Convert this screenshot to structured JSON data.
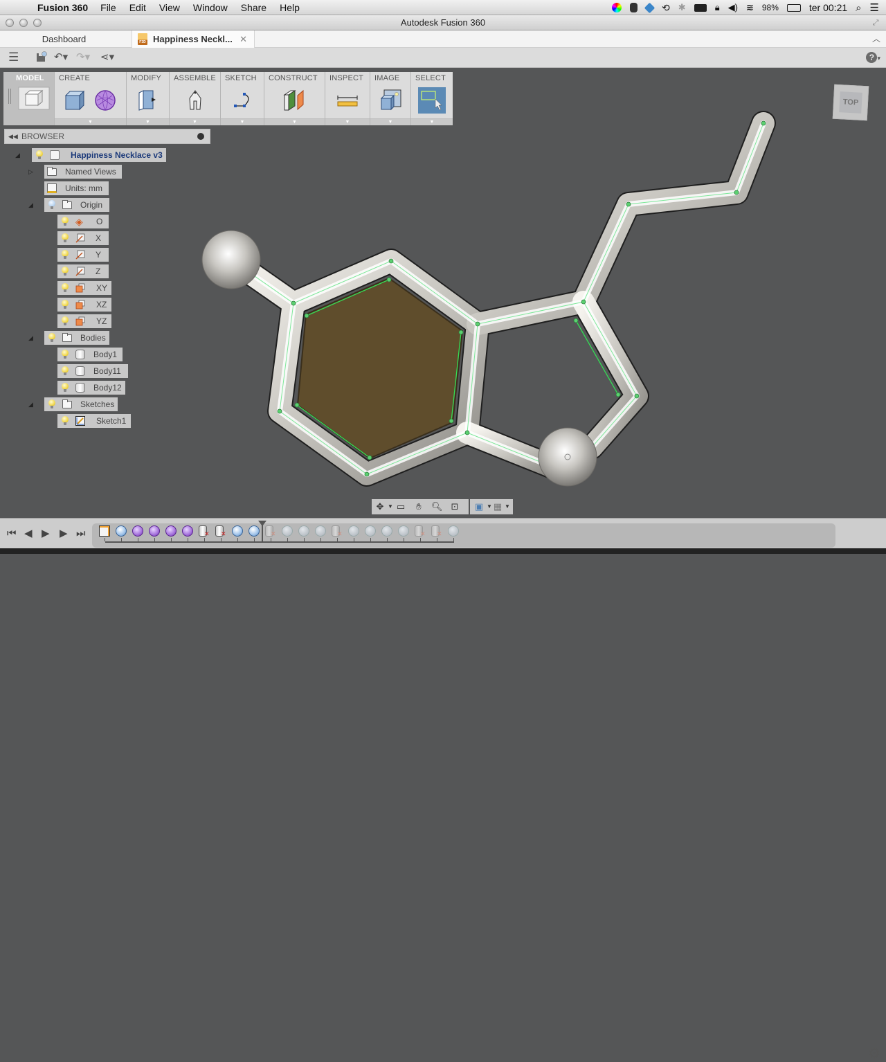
{
  "menubar": {
    "app": "Fusion 360",
    "items": [
      "File",
      "Edit",
      "View",
      "Window",
      "Share",
      "Help"
    ],
    "battery": "98%",
    "clock": "ter 00:21"
  },
  "window": {
    "title": "Autodesk Fusion 360"
  },
  "tabs": [
    {
      "label": "Dashboard",
      "active": false
    },
    {
      "label": "Happiness Neckl...",
      "active": true,
      "icon": "F3D"
    }
  ],
  "ribbon": {
    "workspace": "MODEL",
    "groups": [
      {
        "label": "CREATE"
      },
      {
        "label": "MODIFY"
      },
      {
        "label": "ASSEMBLE"
      },
      {
        "label": "SKETCH"
      },
      {
        "label": "CONSTRUCT"
      },
      {
        "label": "INSPECT"
      },
      {
        "label": "IMAGE"
      },
      {
        "label": "SELECT"
      }
    ]
  },
  "browser": {
    "title": "BROWSER",
    "root": "Happiness Necklace v3",
    "named_views": "Named Views",
    "units": "Units: mm",
    "origin": {
      "label": "Origin",
      "items": [
        "O",
        "X",
        "Y",
        "Z",
        "XY",
        "XZ",
        "YZ"
      ]
    },
    "bodies": {
      "label": "Bodies",
      "items": [
        "Body1",
        "Body11",
        "Body12"
      ]
    },
    "sketches": {
      "label": "Sketches",
      "items": [
        "Sketch1"
      ]
    }
  },
  "viewcube": {
    "face": "TOP"
  },
  "timeline": {
    "items": [
      "sketch",
      "sphere",
      "tsphere",
      "tsphere",
      "tsphere",
      "tsphere",
      "body-x",
      "body-x",
      "sphere",
      "sphere",
      "body-x-disabled",
      "sphere-disabled",
      "sphere-disabled",
      "sphere-disabled",
      "body-x-disabled",
      "sphere-disabled",
      "sphere-disabled",
      "sphere-disabled",
      "sphere-disabled",
      "body-x-disabled",
      "body-x-disabled",
      "sphere-disabled"
    ]
  },
  "colors": {
    "canvas": "#555657",
    "select_active": "#5b8ab5",
    "tree_root_text": "#1c3a7a",
    "fill_brown": "#5f4d2c",
    "sketch_green": "#33dd55"
  }
}
